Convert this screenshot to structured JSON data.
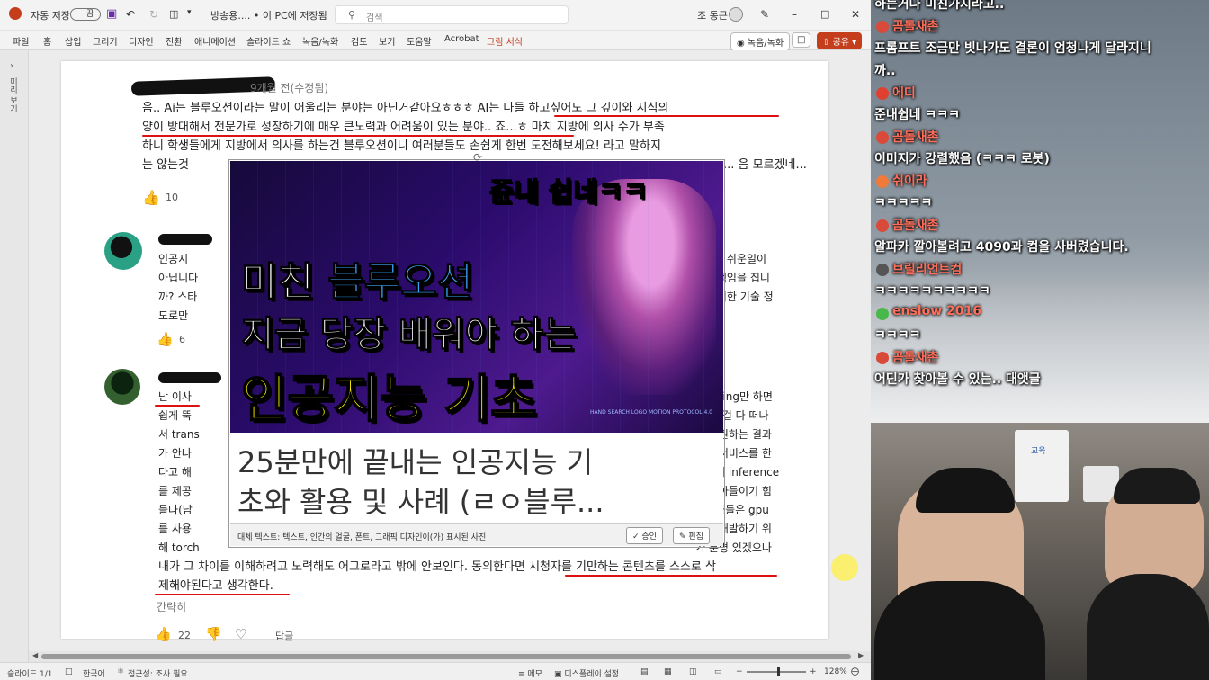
{
  "titlebar": {
    "autosave_label": "자동 저장",
    "autosave_state": "끔",
    "doc_title": "방송용.... • 이 PC에 저장됨",
    "search_placeholder": "검색",
    "user": "조 동근"
  },
  "ribbon": {
    "tabs": [
      "파일",
      "홈",
      "삽입",
      "그리기",
      "디자인",
      "전환",
      "애니메이션",
      "슬라이드 쇼",
      "녹음/녹화",
      "검토",
      "보기",
      "도움말",
      "Acrobat",
      "그림 서식"
    ],
    "record_button": "녹음/녹화",
    "share_button": "공유"
  },
  "leftstrip": {
    "label": "미리 보기"
  },
  "comments": [
    {
      "meta": "9개월 전(수정됨)",
      "lines": [
        "음.. Ai는 블루오션이라는 말이 어울리는 분야는 아닌거같아요ㅎㅎㅎ AI는 다들 하고싶어도 그 깊이와 지식의",
        "양이 방대해서 전문가로 성장하기에 매우 큰노력과 어려움이 있는 분야.. 죠...ㅎ 마치 지방에 의사 수가 부족",
        "하니 학생들에게 지방에서 의사를 하는건 블루오션이니 여러분들도 손쉽게 한번 도전해보세요! 라고 말하지",
        "는 않는것",
        "... 음 모르겠네..."
      ],
      "likes": "10"
    },
    {
      "lines_left": [
        "인공지",
        "아닙니다",
        "까? 스타",
        "도로만"
      ],
      "lines_right": [
        "다는게 쉬운일이",
        "누가 책임을 집니",
        "상 신기한 기술 정"
      ],
      "likes": "6"
    },
    {
      "lines_left": [
        "난 이사",
        "쉽게 뚝",
        "서 trans",
        "가 안나",
        "다고 해",
        "를 제공",
        "들다(남",
        "를 사용",
        "해 torch"
      ],
      "lines_right": [
        "learning만 하면",
        ", 다른걸 다 떠나",
        "든데 원하는 결과",
        "들던 서비스를 한",
        "수준의 inference",
        "팔 받아들이기 힘",
        "개발자들은 gpu",
        "까지 개발하기 위",
        "가 분명 있겠으나"
      ],
      "tail_lines": [
        "내가 그 차이를 이해하려고 노력해도 어그로라고 밖에 안보인다. 동의한다면 시청자를 기만하는 콘텐츠를 스스로 삭",
        "제해야된다고 생각한다."
      ],
      "more": "간략히",
      "likes": "22",
      "reply": "답글"
    }
  ],
  "thumbnail": {
    "top_caption": "쥰내 쉽네ㅋㅋ",
    "line1a": "미친 ",
    "line1b": "블루오션",
    "line2": "지금 당장 배워야 하는",
    "line3": "인공지능 기초",
    "small_text": "HAND SEARCH LOGO MOTION PROTOCOL 4.0",
    "card_title_1": "25분만에 끝내는 인공지능 기",
    "card_title_2": "초와 활용 및 사례 (ㄹㅇ블루...",
    "alt_text": "대체 텍스트: 텍스트, 인간의 얼굴, 폰트, 그래픽 디자인이(가) 표시된 사진",
    "approve": "승인",
    "edit": "편집"
  },
  "status": {
    "slide": "슬라이드 1/1",
    "lang": "한국어",
    "access": "접근성: 조사 필요",
    "notes": "메모",
    "display": "디스플레이 설정",
    "zoom": "128%"
  },
  "chat": [
    {
      "type": "msg",
      "text": "하는거나 미친가지라고.."
    },
    {
      "type": "name",
      "name": "곰돌새촌",
      "color": "#d94a3a"
    },
    {
      "type": "msg",
      "text": "프롬프트 조금만 빗나가도 결론이 엄청나게 달라지니"
    },
    {
      "type": "msg",
      "text": "까.."
    },
    {
      "type": "name",
      "name": "에디",
      "color": "#e0402f"
    },
    {
      "type": "msg",
      "text": "준내쉽네 ㅋㅋㅋ"
    },
    {
      "type": "name",
      "name": "곰돌새촌",
      "color": "#d94a3a"
    },
    {
      "type": "msg",
      "text": "이미지가 강렬했음 (ㅋㅋㅋ 로봇)"
    },
    {
      "type": "name",
      "name": "쉬이라",
      "color": "#f07a3a"
    },
    {
      "type": "msg",
      "text": "ㅋㅋㅋㅋㅋ"
    },
    {
      "type": "name",
      "name": "곰돌새촌",
      "color": "#d94a3a"
    },
    {
      "type": "msg",
      "text": "알파카 깔아볼려고 4090과 컴을 사버렸습니다."
    },
    {
      "type": "name",
      "name": "브릴리언트컴",
      "color": "#555555"
    },
    {
      "type": "msg",
      "text": "ㅋㅋㅋㅋㅋㅋㅋㅋㅋㅋ"
    },
    {
      "type": "name",
      "name": "enslow 2016",
      "color": "#49b84a"
    },
    {
      "type": "msg",
      "text": "ㅋㅋㅋㅋ"
    },
    {
      "type": "name",
      "name": "곰돌새촌",
      "color": "#d94a3a"
    },
    {
      "type": "msg",
      "text": "어딘가 찾아볼 수 있는.. 대앳글"
    }
  ],
  "cam": {
    "badge": "교육"
  }
}
